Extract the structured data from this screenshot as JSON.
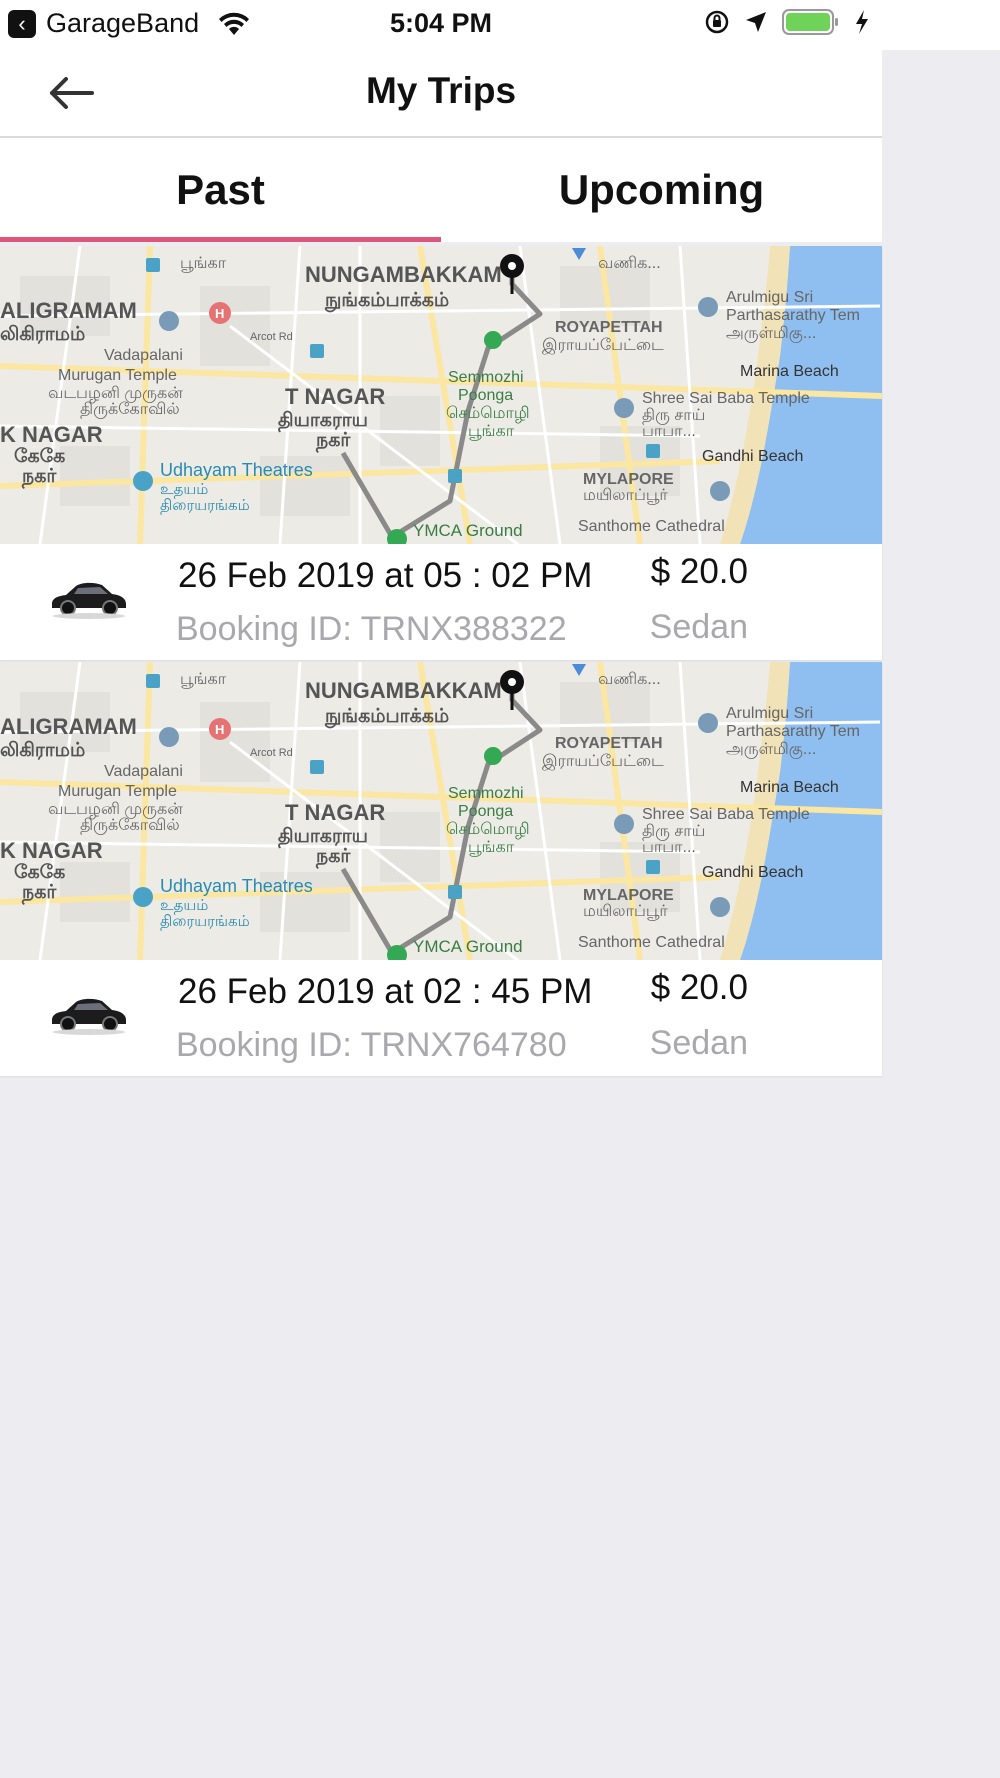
{
  "status_bar": {
    "back_app_label": "GarageBand",
    "time": "5:04 PM"
  },
  "header": {
    "title": "My Trips"
  },
  "tabs": [
    {
      "label": "Past",
      "active": true
    },
    {
      "label": "Upcoming",
      "active": false
    }
  ],
  "accent_color": "#e0567a",
  "map": {
    "labels": {
      "nungambakkam": "NUNGAMBAKKAM",
      "nungambakkam_ta": "நுங்கம்பாக்கம்",
      "aligramam": "ALIGRAMAM",
      "aligramam_ta": "லிகிராமம்",
      "vadapalani": "Vadapalani",
      "murugan_temple": "Murugan Temple",
      "murugan_ta1": "வடபழனி முருகன்",
      "murugan_ta2": "திருக்கோவில்",
      "k_nagar": "K NAGAR",
      "k_nagar_ta1": "கேகே",
      "k_nagar_ta2": "நகர்",
      "t_nagar": "T NAGAR",
      "t_nagar_ta1": "தியாகராய",
      "t_nagar_ta2": "நகர்",
      "semmozhi": "Semmozhi",
      "poonga": "Poonga",
      "semmozhi_ta1": "செம்மொழி",
      "semmozhi_ta2": "பூங்கா",
      "royapettah": "ROYAPETTAH",
      "royapettah_ta": "இராயப்பேட்டை",
      "arulmigu1": "Arulmigu Sri",
      "arulmigu2": "Parthasarathy Tem",
      "arulmigu_ta": "அருள்மிகு...",
      "marina": "Marina Beach",
      "shree_sai": "Shree Sai Baba Temple",
      "sai_ta1": "திரு சாய்",
      "sai_ta2": "பாபா...",
      "gandhi": "Gandhi Beach",
      "mylapore": "MYLAPORE",
      "mylapore_ta": "மயிலாப்பூர்",
      "santhome": "Santhome Cathedral",
      "udhayam": "Udhayam Theatres",
      "udhayam_ta1": "உதயம்",
      "udhayam_ta2": "திரையரங்கம்",
      "ymca": "YMCA Ground",
      "arcot": "Arcot Rd",
      "top_left_ta": "பூங்கா",
      "top_right_ta": "வணிக..."
    }
  },
  "trips": [
    {
      "date": "26 Feb 2019 at 05 : 02 PM",
      "booking_id": "Booking ID: TRNX388322",
      "price": "$ 20.0",
      "vehicle_type": "Sedan"
    },
    {
      "date": "26 Feb 2019 at 02 : 45 PM",
      "booking_id": "Booking ID: TRNX764780",
      "price": "$ 20.0",
      "vehicle_type": "Sedan"
    }
  ]
}
